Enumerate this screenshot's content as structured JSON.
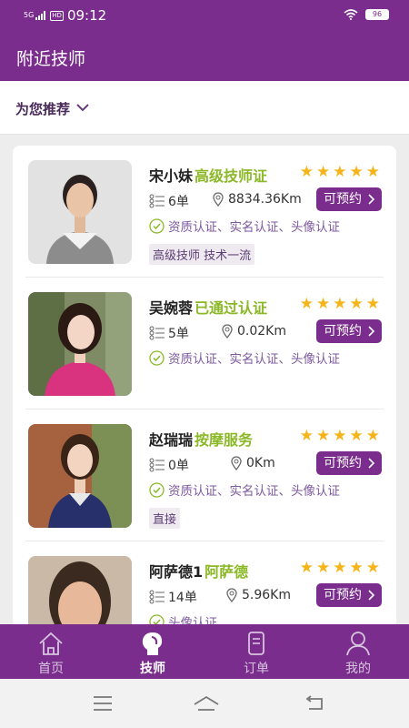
{
  "status_bar": {
    "network": "5G",
    "hd": "HD",
    "time": "09:12",
    "battery": "96"
  },
  "header": {
    "title": "附近技师"
  },
  "filter": {
    "label": "为您推荐",
    "icon": "chevron-down-icon"
  },
  "technicians": [
    {
      "name": "宋小妹",
      "title": "高级技师证",
      "rating": 5,
      "orders": "6单",
      "distance": "8834.36Km",
      "book_label": "可预约",
      "certs": "资质认证、实名认证、头像认证",
      "tag": "高级技师 技术一流"
    },
    {
      "name": "吴婉蓉",
      "title": "已通过认证",
      "rating": 5,
      "orders": "5单",
      "distance": "0.02Km",
      "book_label": "可预约",
      "certs": "资质认证、实名认证、头像认证",
      "tag": ""
    },
    {
      "name": "赵瑞瑞",
      "title": "按摩服务",
      "rating": 5,
      "orders": "0单",
      "distance": "0Km",
      "book_label": "可预约",
      "certs": "资质认证、实名认证、头像认证",
      "tag": "直接"
    },
    {
      "name": "阿萨德1",
      "title": "阿萨德",
      "rating": 5,
      "orders": "14单",
      "distance": "5.96Km",
      "book_label": "可预约",
      "certs": "头像认证",
      "tag": ""
    }
  ],
  "tabs": [
    {
      "label": "首页",
      "icon": "home-icon",
      "active": false
    },
    {
      "label": "技师",
      "icon": "technician-head-icon",
      "active": true
    },
    {
      "label": "订单",
      "icon": "order-list-icon",
      "active": false
    },
    {
      "label": "我的",
      "icon": "user-icon",
      "active": false
    }
  ],
  "colors": {
    "brand": "#7a2d8c",
    "accent_green": "#8bb827",
    "star": "#f5b418"
  }
}
